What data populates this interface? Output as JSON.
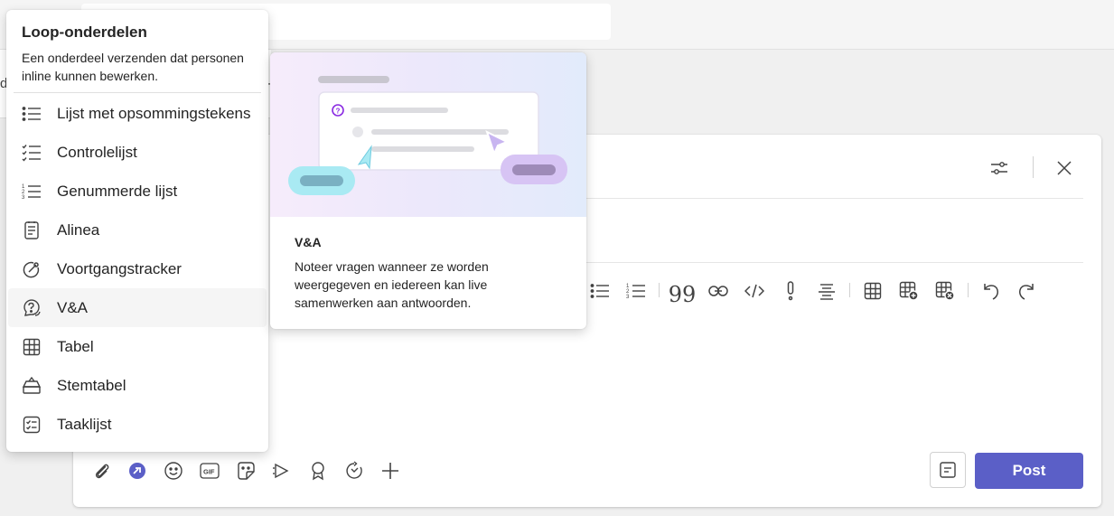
{
  "background": {
    "left_letter": "d",
    "dash": "-"
  },
  "loop_menu": {
    "title": "Loop-onderdelen",
    "description": "Een onderdeel verzenden dat personen inline kunnen bewerken.",
    "items": [
      {
        "label": "Lijst met opsommingstekens",
        "icon": "bullet-list-icon"
      },
      {
        "label": "Controlelijst",
        "icon": "checklist-icon"
      },
      {
        "label": "Genummerde lijst",
        "icon": "numbered-list-icon"
      },
      {
        "label": "Alinea",
        "icon": "paragraph-icon"
      },
      {
        "label": "Voortgangstracker",
        "icon": "progress-tracker-icon"
      },
      {
        "label": "V&A",
        "icon": "qa-icon",
        "active": true
      },
      {
        "label": "Tabel",
        "icon": "table-icon"
      },
      {
        "label": "Stemtabel",
        "icon": "voting-table-icon"
      },
      {
        "label": "Taaklijst",
        "icon": "task-list-icon"
      }
    ]
  },
  "preview": {
    "title": "V&A",
    "description": "Noteer vragen wanneer ze worden weergegeven en iedereen kan live samenwerken aan antwoorden."
  },
  "compose": {
    "post_label": "Post",
    "colors": {
      "accent": "#5b5fc7",
      "loop_icon": "#5b5fc7"
    }
  }
}
